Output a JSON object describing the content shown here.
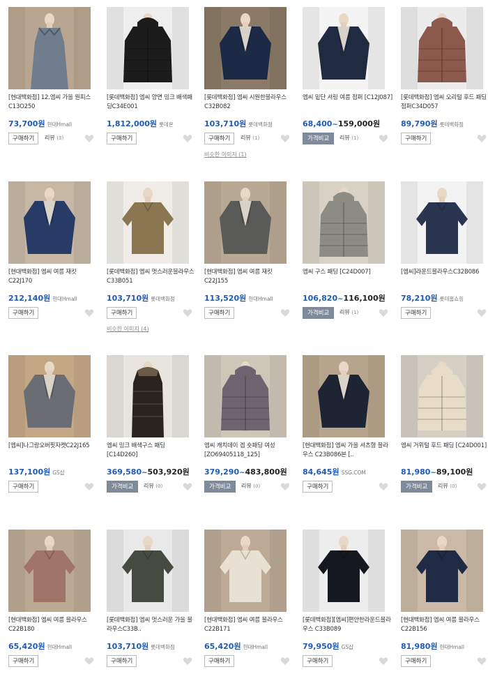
{
  "labels": {
    "buy": "구매하기",
    "compare": "가격비교",
    "review": "리뷰"
  },
  "colors": {
    "price": "#1e5bb8",
    "compare_button": "#7f8b9b",
    "heart": "#d9d9d9"
  },
  "products": [
    {
      "title": "[현대백화점] 12.엠씨 가을 원피스 C13O250",
      "price": "73,700원",
      "mall": "현대Hmall",
      "button": "buy",
      "review": "(3)",
      "similar": "",
      "thumb": {
        "bg": "#b9a690",
        "item": "#6f7d8c",
        "shape": "dress"
      }
    },
    {
      "title": "[롯데백화점] 엠씨 양면 밍크 배색패딩C34E001",
      "price": "1,812,000원",
      "mall": "롯데온",
      "button": "buy",
      "review": "",
      "similar": "",
      "thumb": {
        "bg": "#eeeeee",
        "item": "#1c1c1c",
        "shape": "padding"
      }
    },
    {
      "title": "[롯데백화점] 엠씨 시원한블라우스C32B082",
      "price": "103,710원",
      "mall": "롯데백화점",
      "button": "buy",
      "review": "(1)",
      "similar": "비슷한 이미지 (1)",
      "thumb": {
        "bg": "#8a7a66",
        "item": "#1d2a45",
        "shape": "jacket"
      }
    },
    {
      "title": "엠씨 밑단 셔링 여름 점퍼 [C12J087]",
      "price": "68,400",
      "price_max": "159,000원",
      "mall": "",
      "button": "compare",
      "review": "(1)",
      "similar": "",
      "thumb": {
        "bg": "#f4f4f4",
        "item": "#202a40",
        "shape": "jacket"
      }
    },
    {
      "title": "[롯데백화점] 엠씨 오리털 후드 패딩점퍼C34D057",
      "price": "89,790원",
      "mall": "롯데백화점",
      "button": "buy",
      "review": "",
      "similar": "",
      "thumb": {
        "bg": "#ececec",
        "item": "#8c5a4c",
        "shape": "padding"
      }
    },
    {
      "title": "[현대백화점] 엠씨 여름 재킷 C22J170",
      "price": "212,140원",
      "mall": "현대Hmall",
      "button": "buy",
      "review": "",
      "similar": "",
      "thumb": {
        "bg": "#c7b8a5",
        "item": "#283a66",
        "shape": "jacket"
      }
    },
    {
      "title": "[롯데백화점] 엠씨 멋스러운블라우스C33B051",
      "price": "103,710원",
      "mall": "롯데백화점",
      "button": "buy",
      "review": "",
      "similar": "비슷한 이미지 (4)",
      "thumb": {
        "bg": "#f0ede8",
        "item": "#8a7650",
        "shape": "blouse"
      }
    },
    {
      "title": "[현대백화점] 엠씨 여름 재킷 C22J155",
      "price": "113,520원",
      "mall": "현대Hmall",
      "button": "buy",
      "review": "",
      "similar": "",
      "thumb": {
        "bg": "#b8a994",
        "item": "#5a5a58",
        "shape": "jacket"
      }
    },
    {
      "title": "엠씨 구스 패딩 [C24D007]",
      "price": "106,820",
      "price_max": "116,100원",
      "mall": "",
      "button": "compare",
      "review": "(1)",
      "similar": "",
      "thumb": {
        "bg": "#d8d2c6",
        "item": "#8c8c84",
        "shape": "padding"
      }
    },
    {
      "title": "[엠씨]라운드블라우스C32B086",
      "price": "78,210원",
      "mall": "롯데홈쇼핑",
      "button": "buy",
      "review": "",
      "similar": "",
      "thumb": {
        "bg": "#f3f3f3",
        "item": "#2a3550",
        "shape": "blouse"
      }
    },
    {
      "title": "[엠씨]나그랑오버핏자켓C22J165",
      "price": "137,100원",
      "mall": "GS샵",
      "button": "buy",
      "review": "",
      "similar": "",
      "thumb": {
        "bg": "#c4a886",
        "item": "#6a6e74",
        "shape": "jacket"
      }
    },
    {
      "title": "엠씨 밍크 배색구스 패딩 [C14D260]",
      "price": "369,580",
      "price_max": "503,920원",
      "mall": "",
      "button": "compare",
      "review": "(0)",
      "similar": "",
      "thumb": {
        "bg": "#e8e4de",
        "item": "#2a2420",
        "shape": "long"
      }
    },
    {
      "title": "엠씨 캐치데이 겝 숏패딩 여성 [ZO69405118_125]",
      "price": "379,290",
      "price_max": "483,800원",
      "mall": "",
      "button": "compare",
      "review": "(0)",
      "similar": "",
      "thumb": {
        "bg": "#cfc6b8",
        "item": "#6d6470",
        "shape": "padding"
      }
    },
    {
      "title": "[현대백화점] 엠씨 가을 셔츠형 블라우스 C23B086본 [..",
      "price": "84,645원",
      "mall": "SSG.COM",
      "button": "buy",
      "review": "",
      "similar": "",
      "thumb": {
        "bg": "#b7a48c",
        "item": "#1d2433",
        "shape": "jacket"
      }
    },
    {
      "title": "엠씨 거위털 후드 패딩 [C24D001]",
      "price": "81,980",
      "price_max": "89,100원",
      "mall": "",
      "button": "compare",
      "review": "(0)",
      "similar": "",
      "thumb": {
        "bg": "#d6cfc4",
        "item": "#e6dcc8",
        "shape": "padding"
      }
    },
    {
      "title": "[현대백화점] 엠씨 여름 블라우스 C22B180",
      "price": "65,420원",
      "mall": "현대Hmall",
      "button": "buy",
      "review": "",
      "similar": "",
      "thumb": {
        "bg": "#bba994",
        "item": "#a07468",
        "shape": "blouse"
      }
    },
    {
      "title": "[롯데백화점] 엠씨 멋스러운 가을 블라우스C33B..",
      "price": "103,710원",
      "mall": "롯데백화점",
      "button": "buy",
      "review": "",
      "similar": "",
      "thumb": {
        "bg": "#e9e9e9",
        "item": "#464b42",
        "shape": "blouse"
      }
    },
    {
      "title": "[현대백화점] 엠씨 여름 블라우스 C22B171",
      "price": "65,420원",
      "mall": "현대Hmall",
      "button": "buy",
      "review": "",
      "similar": "",
      "thumb": {
        "bg": "#bca996",
        "item": "#e8e0d2",
        "shape": "blouse"
      }
    },
    {
      "title": "[롯데백화점][엠씨]편안한라운드블라우스 C33B089",
      "price": "79,950원",
      "mall": "GS샵",
      "button": "buy",
      "review": "",
      "similar": "",
      "thumb": {
        "bg": "#ededed",
        "item": "#15181f",
        "shape": "blouse"
      }
    },
    {
      "title": "[현대백화점] 엠씨 여름 블라우스 C22B156",
      "price": "81,980원",
      "mall": "현대Hmall",
      "button": "buy",
      "review": "",
      "similar": "",
      "thumb": {
        "bg": "#c9b9a6",
        "item": "#1f2a44",
        "shape": "blouse"
      }
    }
  ]
}
